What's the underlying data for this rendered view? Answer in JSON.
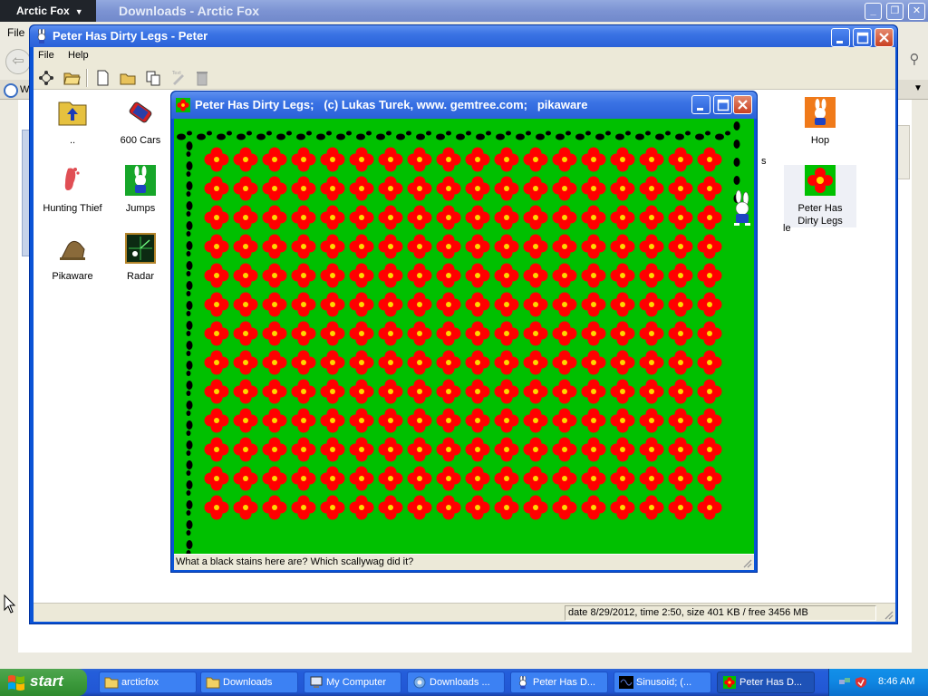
{
  "browser": {
    "menu_button": "Arctic Fox",
    "title": "Downloads - Arctic Fox",
    "menu_file": "File",
    "tab_text": "W"
  },
  "explorer": {
    "title": "Peter Has Dirty Legs - Peter",
    "menu": [
      "File",
      "Help"
    ],
    "items": [
      {
        "label": "..",
        "icon": "folder-up-icon"
      },
      {
        "label": "600 Cars",
        "icon": "car-icon"
      },
      {
        "label": "Hunting Thief",
        "icon": "footprint-icon"
      },
      {
        "label": "Jumps",
        "icon": "rabbit-icon"
      },
      {
        "label": "Pikaware",
        "icon": "pikaware-icon"
      },
      {
        "label": "Radar",
        "icon": "radar-icon"
      },
      {
        "label": "Hop",
        "icon": "rabbit-orange-icon"
      },
      {
        "label": "Peter Has\nDirty Legs",
        "icon": "flower-icon"
      }
    ],
    "partial_labels": [
      "s",
      "le"
    ],
    "status": "date 8/29/2012, time 2:50, size 401 KB / free 3456 MB"
  },
  "game": {
    "title": "Peter Has Dirty Legs;   (c) Lukas Turek, www. gemtree.com;   pikaware",
    "status": "What a black stains here are? Which scallywag did it?",
    "field": {
      "background": "#00c000",
      "flower_petal": "#ff0000",
      "flower_center": "#ffd700",
      "rows": 13,
      "cols": 18,
      "footprint_color": "#000000"
    }
  },
  "taskbar": {
    "start": "start",
    "buttons": [
      {
        "label": "arcticfox",
        "icon": "folder-icon"
      },
      {
        "label": "Downloads",
        "icon": "folder-icon"
      },
      {
        "label": "My Computer",
        "icon": "computer-icon"
      },
      {
        "label": "Downloads ...",
        "icon": "arctic-fox-icon"
      },
      {
        "label": "Peter Has D...",
        "icon": "rabbit-icon"
      },
      {
        "label": "Sinusoid;  (...",
        "icon": "sinusoid-icon"
      },
      {
        "label": "Peter Has D...",
        "icon": "flower-icon",
        "active": true
      }
    ],
    "clock": "8:46 AM"
  }
}
